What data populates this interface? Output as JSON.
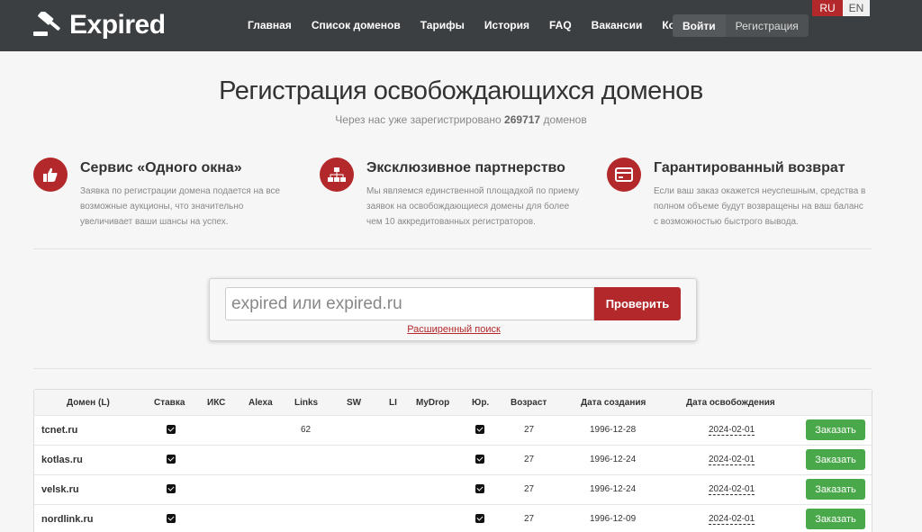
{
  "header": {
    "logo_text": "Expired",
    "nav": [
      "Главная",
      "Список доменов",
      "Тарифы",
      "История",
      "FAQ",
      "Вакансии",
      "Контакты"
    ],
    "login_label": "Войти",
    "register_label": "Регистрация",
    "lang_ru": "RU",
    "lang_en": "EN"
  },
  "hero": {
    "title": "Регистрация освобождающихся доменов",
    "subtitle_prefix": "Через нас уже зарегистрировано",
    "count": "269717",
    "subtitle_suffix": "доменов"
  },
  "features": [
    {
      "icon": "thumbs-up-icon",
      "title": "Сервис «Одного окна»",
      "text": "Заявка по регистрации домена подается на все возможные аукционы, что значительно увеличивает ваши шансы на успех."
    },
    {
      "icon": "sitemap-icon",
      "title": "Эксклюзивное партнерство",
      "text": "Мы являемся единственной площадкой по приему заявок на освобождающиеся домены для более чем 10 аккредитованных регистраторов."
    },
    {
      "icon": "credit-card-icon",
      "title": "Гарантированный возврат",
      "text": "Если ваш заказ окажется неуспешным, средства в полном объеме будут возвращены на ваш баланс с возможностью быстрого вывода."
    }
  ],
  "search": {
    "placeholder": "expired или expired.ru",
    "button_label": "Проверить",
    "advanced_label": "Расширенный поиск"
  },
  "table": {
    "headers": [
      "Домен (L)",
      "Ставка",
      "ИКС",
      "Alexa",
      "Links",
      "SW",
      "LI",
      "MyDrop",
      "Юр.",
      "Возраст",
      "Дата создания",
      "Дата освобождения"
    ],
    "order_label": "Заказать",
    "rows": [
      {
        "domain": "tcnet.ru",
        "links": "62",
        "age": "27",
        "created": "1996-12-28",
        "release": "2024-02-01"
      },
      {
        "domain": "kotlas.ru",
        "links": "",
        "age": "27",
        "created": "1996-12-24",
        "release": "2024-02-01"
      },
      {
        "domain": "velsk.ru",
        "links": "",
        "age": "27",
        "created": "1996-12-24",
        "release": "2024-02-01"
      },
      {
        "domain": "nordlink.ru",
        "links": "",
        "age": "27",
        "created": "1996-12-09",
        "release": "2024-02-01"
      }
    ]
  },
  "colors": {
    "brand_red": "#b3282b",
    "header_bg": "#3c3f41",
    "order_green": "#49a849"
  }
}
